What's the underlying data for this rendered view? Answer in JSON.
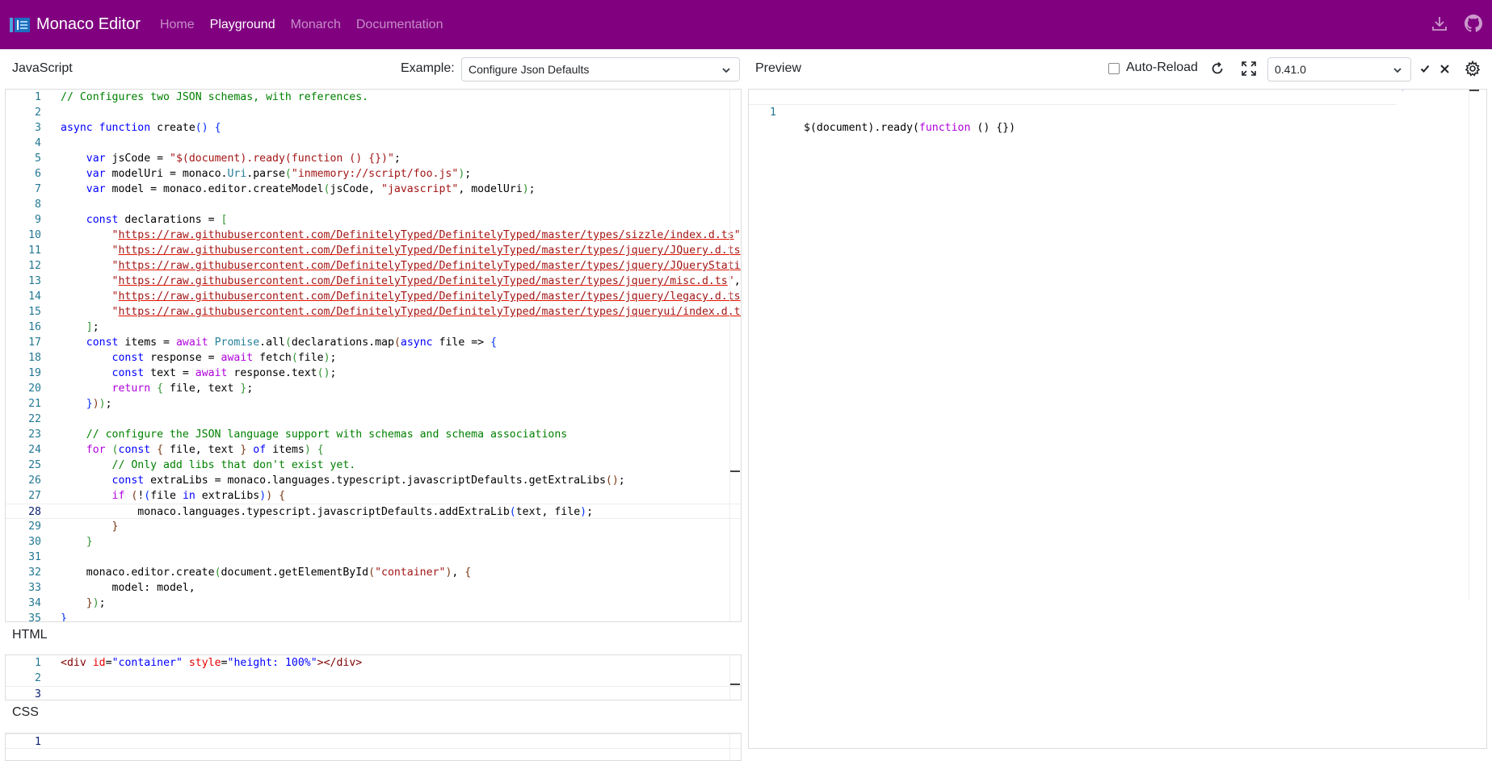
{
  "header": {
    "brand": "Monaco Editor",
    "nav": [
      {
        "label": "Home"
      },
      {
        "label": "Playground"
      },
      {
        "label": "Monarch"
      },
      {
        "label": "Documentation"
      }
    ]
  },
  "js_pane": {
    "title": "JavaScript",
    "example_label": "Example:",
    "example_value": "Configure Json Defaults",
    "current_line": "28"
  },
  "preview_pane": {
    "title": "Preview",
    "auto_reload": "Auto-Reload",
    "version": "0.41.0",
    "line1_no": "1",
    "line1_code": "$(document).ready(function () {})"
  },
  "html_pane": {
    "title": "HTML",
    "lines": [
      "1",
      "2",
      "3"
    ]
  },
  "css_pane": {
    "title": "CSS",
    "lines": [
      "1"
    ]
  },
  "colors": {
    "header_bg": "#800080",
    "line_number": "#237893"
  }
}
